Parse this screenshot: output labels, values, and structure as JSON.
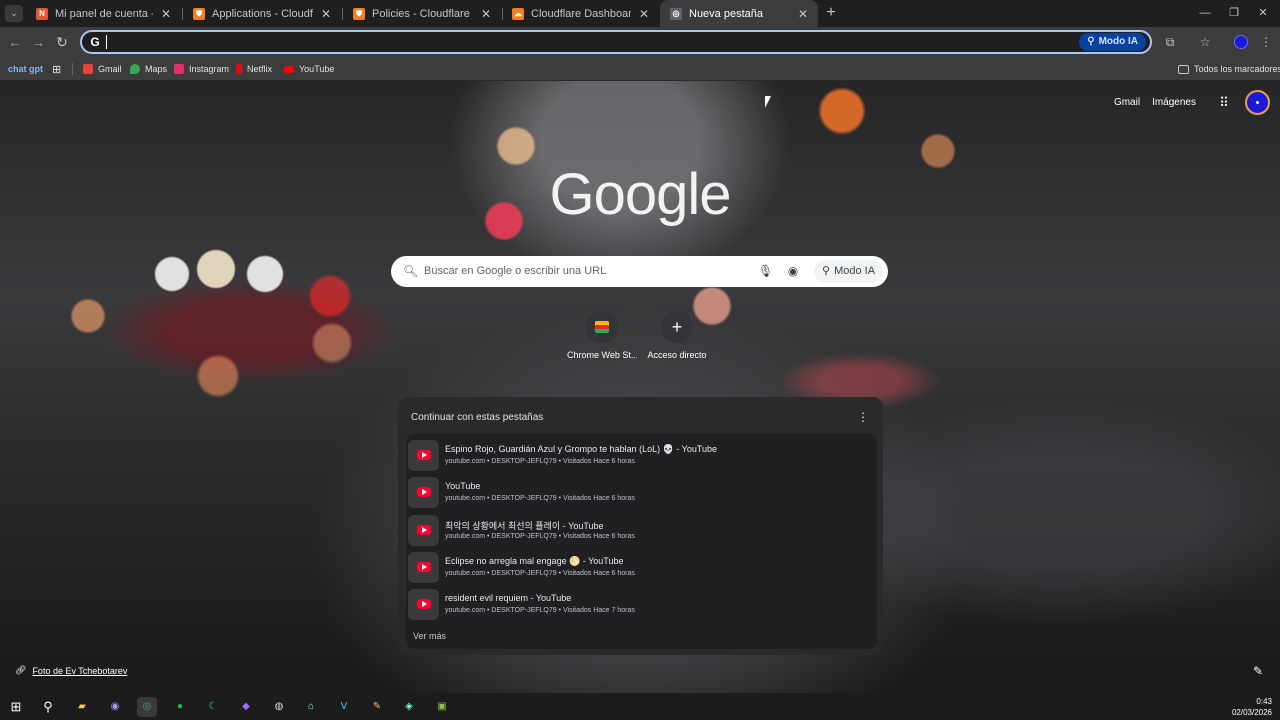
{
  "tabs": [
    {
      "title": "Mi panel de cuenta - Namecheap",
      "favicon_color": "#de5833",
      "favicon_glyph": "N"
    },
    {
      "title": "Applications - Cloudflare One",
      "favicon_color": "#f38020",
      "favicon_glyph": "⛊"
    },
    {
      "title": "Policies - Cloudflare One",
      "favicon_color": "#f38020",
      "favicon_glyph": "⛊"
    },
    {
      "title": "Cloudflare Dashboard | Manage",
      "favicon_color": "#f38020",
      "favicon_glyph": "☁"
    },
    {
      "title": "Nueva pestaña",
      "favicon_color": "#9aa0a6",
      "favicon_glyph": "◎"
    }
  ],
  "toolbar": {
    "omnibox_value": "",
    "omnibox_badge": "G",
    "modo_ia_label": "Modo IA"
  },
  "bookmarks": [
    {
      "label": "chat gpt",
      "color": "#8ab4f8"
    },
    {
      "label": "Gmail",
      "color": "#ea4335"
    },
    {
      "label": "Maps",
      "color": "#34a853"
    },
    {
      "label": "Instagram",
      "color": "#e1306c"
    },
    {
      "label": "Netflix",
      "color": "#e50914"
    },
    {
      "label": "YouTube",
      "color": "#ff0000"
    },
    {
      "label": "Todos los marcadores",
      "color": "#c4c7c5"
    }
  ],
  "ntp": {
    "top_links": {
      "gmail": "Gmail",
      "images": "Imágenes"
    },
    "logo": "Google",
    "search_placeholder": "Buscar en Google o escribir una URL",
    "modo_ia_label": "Modo IA",
    "shortcuts": [
      {
        "label": "Chrome Web St..."
      },
      {
        "label": "Acceso directo"
      }
    ],
    "continue_card": {
      "title": "Continuar con estas pestañas",
      "rows": [
        {
          "title": "Espino Rojo, Guardián Azul y Grompo te hablan (LoL) 💀 - YouTube",
          "meta": "youtube.com • DESKTOP-JEFLQ79 • Visitados Hace 6 horas"
        },
        {
          "title": "YouTube",
          "meta": "youtube.com • DESKTOP-JEFLQ79 • Visitados Hace 6 horas"
        },
        {
          "title": "최악의 상황에서 최선의 플레이 - YouTube",
          "meta": "youtube.com • DESKTOP-JEFLQ79 • Visitados Hace 6 horas"
        },
        {
          "title": "Eclipse no arregla mal engage 🌕 - YouTube",
          "meta": "youtube.com • DESKTOP-JEFLQ79 • Visitados Hace 6 horas"
        },
        {
          "title": "resident evil requiem - YouTube",
          "meta": "youtube.com • DESKTOP-JEFLQ79 • Visitados Hace 7 horas"
        }
      ],
      "see_more": "Ver más"
    },
    "photo_credit": "Foto de Ev Tchebotarev"
  },
  "taskbar": {
    "time": "0:43",
    "date": "02/03/2026"
  }
}
